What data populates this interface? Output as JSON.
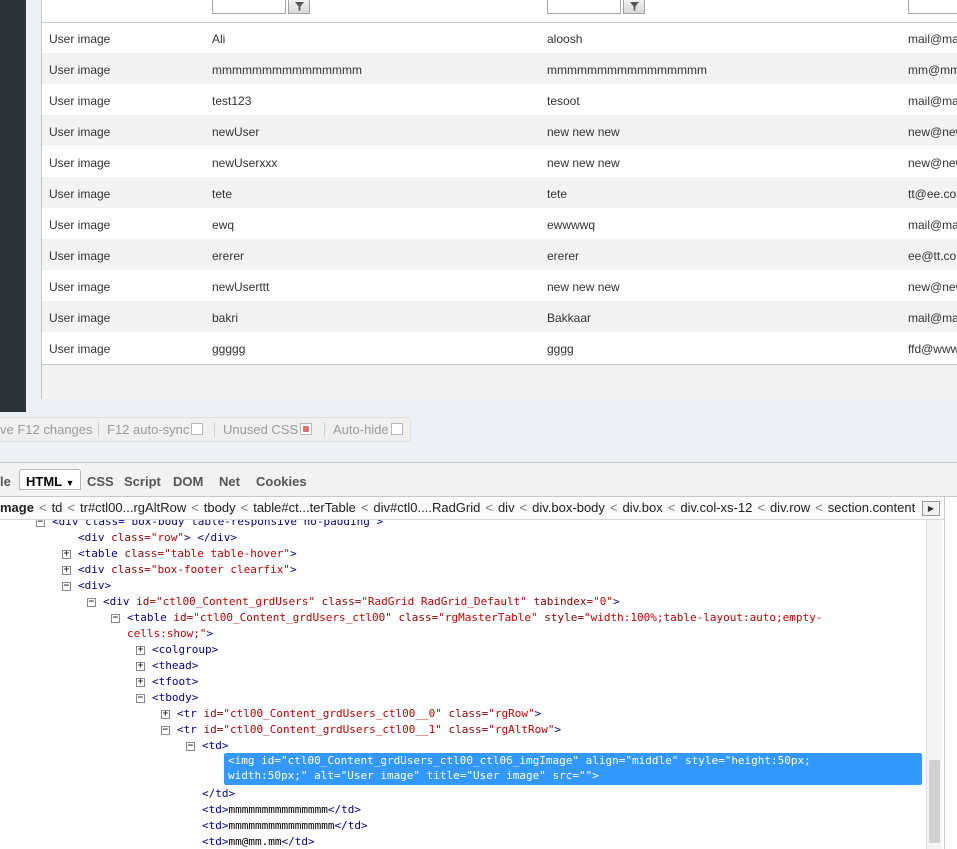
{
  "grid": {
    "rows": [
      {
        "c1": "User image",
        "c2": "Ali",
        "c3": "aloosh",
        "c4": "mail@mail.com"
      },
      {
        "c1": "User image",
        "c2": "mmmmmmmmmmmmmmm",
        "c3": "mmmmmmmmmmmmmmmm",
        "c4": "mm@mm.mm"
      },
      {
        "c1": "User image",
        "c2": "test123",
        "c3": "tesoot",
        "c4": "mail@mail.com"
      },
      {
        "c1": "User image",
        "c2": "newUser",
        "c3": "new new new",
        "c4": "new@new.com"
      },
      {
        "c1": "User image",
        "c2": "newUserxxx",
        "c3": "new new new",
        "c4": "new@new.com"
      },
      {
        "c1": "User image",
        "c2": "tete",
        "c3": "tete",
        "c4": "tt@ee.com"
      },
      {
        "c1": "User image",
        "c2": "ewq",
        "c3": "ewwwwq",
        "c4": "mail@mail.com"
      },
      {
        "c1": "User image",
        "c2": "ererer",
        "c3": "ererer",
        "c4": "ee@tt.com"
      },
      {
        "c1": "User image",
        "c2": "newUserttt",
        "c3": "new new new",
        "c4": "new@new.com"
      },
      {
        "c1": "User image",
        "c2": "bakri",
        "c3": "Bakkaar",
        "c4": "mail@mail.com"
      },
      {
        "c1": "User image",
        "c2": "ggggg",
        "c3": "gggg",
        "c4": "ffd@www.com"
      }
    ]
  },
  "firebug": {
    "status": {
      "save_label": "ve F12 changes",
      "autosync_label": "F12 auto-sync",
      "unused_css_label": "Unused CSS",
      "autohide_label": "Auto-hide"
    },
    "tabs": {
      "left_partial": "le",
      "html": "HTML",
      "css": "CSS",
      "script": "Script",
      "dom": "DOM",
      "net": "Net",
      "cookies": "Cookies"
    },
    "breadcrumb": [
      "mage",
      "td",
      "tr#ctl00...rgAltRow",
      "tbody",
      "table#ct...terTable",
      "div#ctl0....RadGrid",
      "div",
      "div.box-body",
      "div.box",
      "div.col-xs-12",
      "div.row",
      "section.content"
    ],
    "breadcrumb_sep": "<",
    "tree": {
      "l0": "<div class=\"box-body table-responsive no-padding\">",
      "l1": {
        "t1": "<div",
        "a": " class=",
        "v": "\"row\"",
        "t2": ">  </div>"
      },
      "l2": {
        "t1": "<table",
        "a": " class=",
        "v": "\"table table-hover\"",
        "t2": ">"
      },
      "l3": {
        "t1": "<div",
        "a": " class=",
        "v": "\"box-footer clearfix\"",
        "t2": ">"
      },
      "l4": "<div>",
      "l5": {
        "t1": "<div",
        "a1": " id=",
        "v1": "\"ctl00_Content_grdUsers\"",
        "a2": " class=",
        "v2": "\"RadGrid RadGrid_Default\"",
        "a3": " tabindex=",
        "v3": "\"0\"",
        "t2": ">"
      },
      "l6": {
        "t1": "<table",
        "a1": " id=",
        "v1": "\"ctl00_Content_grdUsers_ctl00\"",
        "a2": " class=",
        "v2": "\"rgMasterTable\"",
        "a3": " style=",
        "v3": "\"width:100%;table-layout:auto;empty-",
        "cont": "cells:show;\"",
        "t2": ">"
      },
      "l7": "<colgroup>",
      "l8": "<thead>",
      "l9": "<tfoot>",
      "l10": "<tbody>",
      "l11": {
        "t1": "<tr",
        "a1": " id=",
        "v1": "\"ctl00_Content_grdUsers_ctl00__0\"",
        "a2": " class=",
        "v2": "\"rgRow\"",
        "t2": ">"
      },
      "l12": {
        "t1": "<tr",
        "a1": " id=",
        "v1": "\"ctl00_Content_grdUsers_ctl00__1\"",
        "a2": " class=",
        "v2": "\"rgAltRow\"",
        "t2": ">"
      },
      "l13": "<td>",
      "sel1": "<img id=\"ctl00_Content_grdUsers_ctl00_ctl06_imgImage\" align=\"middle\" style=\"height:50px;",
      "sel2": "width:50px;\" alt=\"User image\" title=\"User image\" src=\"\">",
      "l14": "</td>",
      "l15": {
        "open": "<td>",
        "text": "mmmmmmmmmmmmmmm",
        "close": "</td>"
      },
      "l16": {
        "open": "<td>",
        "text": "mmmmmmmmmmmmmmmm",
        "close": "</td>"
      },
      "l17": {
        "open": "<td>",
        "text": "mm@mm.mm",
        "close": "</td>"
      }
    }
  }
}
